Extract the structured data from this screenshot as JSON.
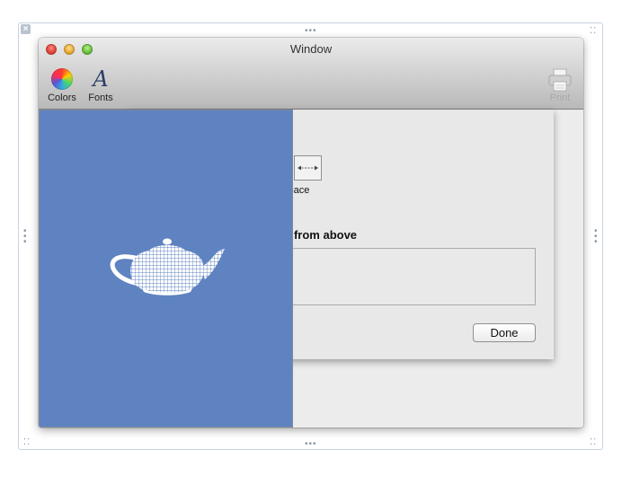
{
  "window": {
    "title": "Window"
  },
  "toolbar": {
    "colors_label": "Colors",
    "fonts_label": "Fonts",
    "print_label": "Print",
    "fonts_icon_glyph": "A"
  },
  "customize_sheet": {
    "flexible_space_label": "ible Space",
    "default_set_heading": "tems from above",
    "done_label": "Done"
  },
  "gl_view": {
    "background_color": "#5f83c1",
    "model": "teapot-wireframe"
  },
  "icons": [
    "close-badge-icon",
    "color-wheel-icon",
    "fonts-icon",
    "printer-icon",
    "flexible-space-icon",
    "teapot-icon"
  ]
}
